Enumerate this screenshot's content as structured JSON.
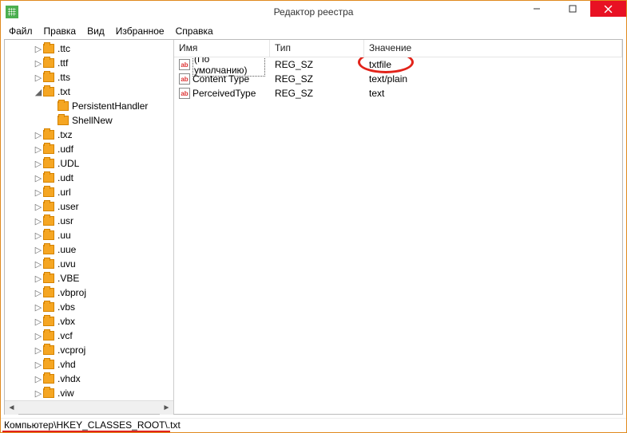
{
  "window": {
    "title": "Редактор реестра"
  },
  "menu": {
    "file": "Файл",
    "edit": "Правка",
    "view": "Вид",
    "favorites": "Избранное",
    "help": "Справка"
  },
  "tree": {
    "items": [
      {
        "indent": 2,
        "tw": "▷",
        "label": ".ttc"
      },
      {
        "indent": 2,
        "tw": "▷",
        "label": ".ttf"
      },
      {
        "indent": 2,
        "tw": "▷",
        "label": ".tts"
      },
      {
        "indent": 2,
        "tw": "◢",
        "label": ".txt"
      },
      {
        "indent": 3,
        "tw": "",
        "label": "PersistentHandler"
      },
      {
        "indent": 3,
        "tw": "",
        "label": "ShellNew"
      },
      {
        "indent": 2,
        "tw": "▷",
        "label": ".txz"
      },
      {
        "indent": 2,
        "tw": "▷",
        "label": ".udf"
      },
      {
        "indent": 2,
        "tw": "▷",
        "label": ".UDL"
      },
      {
        "indent": 2,
        "tw": "▷",
        "label": ".udt"
      },
      {
        "indent": 2,
        "tw": "▷",
        "label": ".url"
      },
      {
        "indent": 2,
        "tw": "▷",
        "label": ".user"
      },
      {
        "indent": 2,
        "tw": "▷",
        "label": ".usr"
      },
      {
        "indent": 2,
        "tw": "▷",
        "label": ".uu"
      },
      {
        "indent": 2,
        "tw": "▷",
        "label": ".uue"
      },
      {
        "indent": 2,
        "tw": "▷",
        "label": ".uvu"
      },
      {
        "indent": 2,
        "tw": "▷",
        "label": ".VBE"
      },
      {
        "indent": 2,
        "tw": "▷",
        "label": ".vbproj"
      },
      {
        "indent": 2,
        "tw": "▷",
        "label": ".vbs"
      },
      {
        "indent": 2,
        "tw": "▷",
        "label": ".vbx"
      },
      {
        "indent": 2,
        "tw": "▷",
        "label": ".vcf"
      },
      {
        "indent": 2,
        "tw": "▷",
        "label": ".vcproj"
      },
      {
        "indent": 2,
        "tw": "▷",
        "label": ".vhd"
      },
      {
        "indent": 2,
        "tw": "▷",
        "label": ".vhdx"
      },
      {
        "indent": 2,
        "tw": "▷",
        "label": ".viw"
      }
    ]
  },
  "columns": {
    "name": "Имя",
    "type": "Тип",
    "value": "Значение"
  },
  "rows": [
    {
      "icon": "ab",
      "name": "(По умолчанию)",
      "type": "REG_SZ",
      "value": "txtfile",
      "selected": true
    },
    {
      "icon": "ab",
      "name": "Content Type",
      "type": "REG_SZ",
      "value": "text/plain",
      "selected": false
    },
    {
      "icon": "ab",
      "name": "PerceivedType",
      "type": "REG_SZ",
      "value": "text",
      "selected": false
    }
  ],
  "status": {
    "path": "Компьютер\\HKEY_CLASSES_ROOT\\.txt"
  }
}
